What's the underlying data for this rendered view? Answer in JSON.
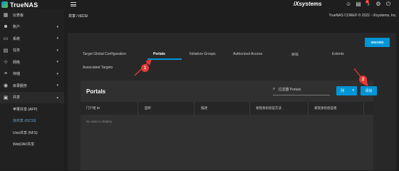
{
  "topbar": {
    "app_name": "TrueNAS",
    "app_sub": "CORE",
    "vendor": "iXsystems",
    "notification_count": "1",
    "icons": [
      "feedback-icon",
      "clipboard-icon",
      "bell-icon",
      "gear-icon",
      "power-icon"
    ]
  },
  "sidebar": {
    "items": [
      {
        "label": "仪表板",
        "icon": "dashboard-icon",
        "glyph": "▦",
        "caret": ""
      },
      {
        "label": "账户",
        "icon": "users-icon",
        "glyph": "👥",
        "caret": "▾"
      },
      {
        "label": "系统",
        "icon": "computer-icon",
        "glyph": "▭",
        "caret": "▾"
      },
      {
        "label": "任务",
        "icon": "calendar-icon",
        "glyph": "▤",
        "caret": "▾"
      },
      {
        "label": "网络",
        "icon": "network-icon",
        "glyph": "⊹",
        "caret": "▾"
      },
      {
        "label": "存储",
        "icon": "storage-icon",
        "glyph": "≡",
        "caret": "▾"
      },
      {
        "label": "目录服务",
        "icon": "directory-icon",
        "glyph": "◉",
        "caret": "▾"
      },
      {
        "label": "共享",
        "icon": "share-folder-icon",
        "glyph": "▣",
        "caret": "▴"
      }
    ],
    "subitems": [
      {
        "label": "苹果共享 (AFP)",
        "active": false
      },
      {
        "label": "块共享 (iSCSI)",
        "active": true
      },
      {
        "label": "Unix共享 (NFS)",
        "active": false
      },
      {
        "label": "WebDAV共享",
        "active": false
      }
    ]
  },
  "breadcrumb": "共享  /  iSCSI",
  "version": "TrueNAS CORE® © 2022 - iXsystems, Inc.",
  "wizard_label": "WIZARD",
  "tabs": [
    "Target Global Configuration",
    "Portals",
    "Initiators Groups",
    "Authorized Access",
    "目标",
    "Extents",
    "Associated Targets"
  ],
  "active_tab": "Portals",
  "panel": {
    "title": "Portals",
    "search_placeholder": "过滤器 Portals",
    "columns_label": "列",
    "add_label": "添加",
    "headers": [
      "门户组 ID",
      "监听",
      "描述",
      "发现身份验证方法",
      "发现身份验证组"
    ],
    "empty_text": "No data to display"
  },
  "annotations": [
    "1",
    "2"
  ],
  "colors": {
    "accent": "#0095d5",
    "marker": "#e53935"
  }
}
